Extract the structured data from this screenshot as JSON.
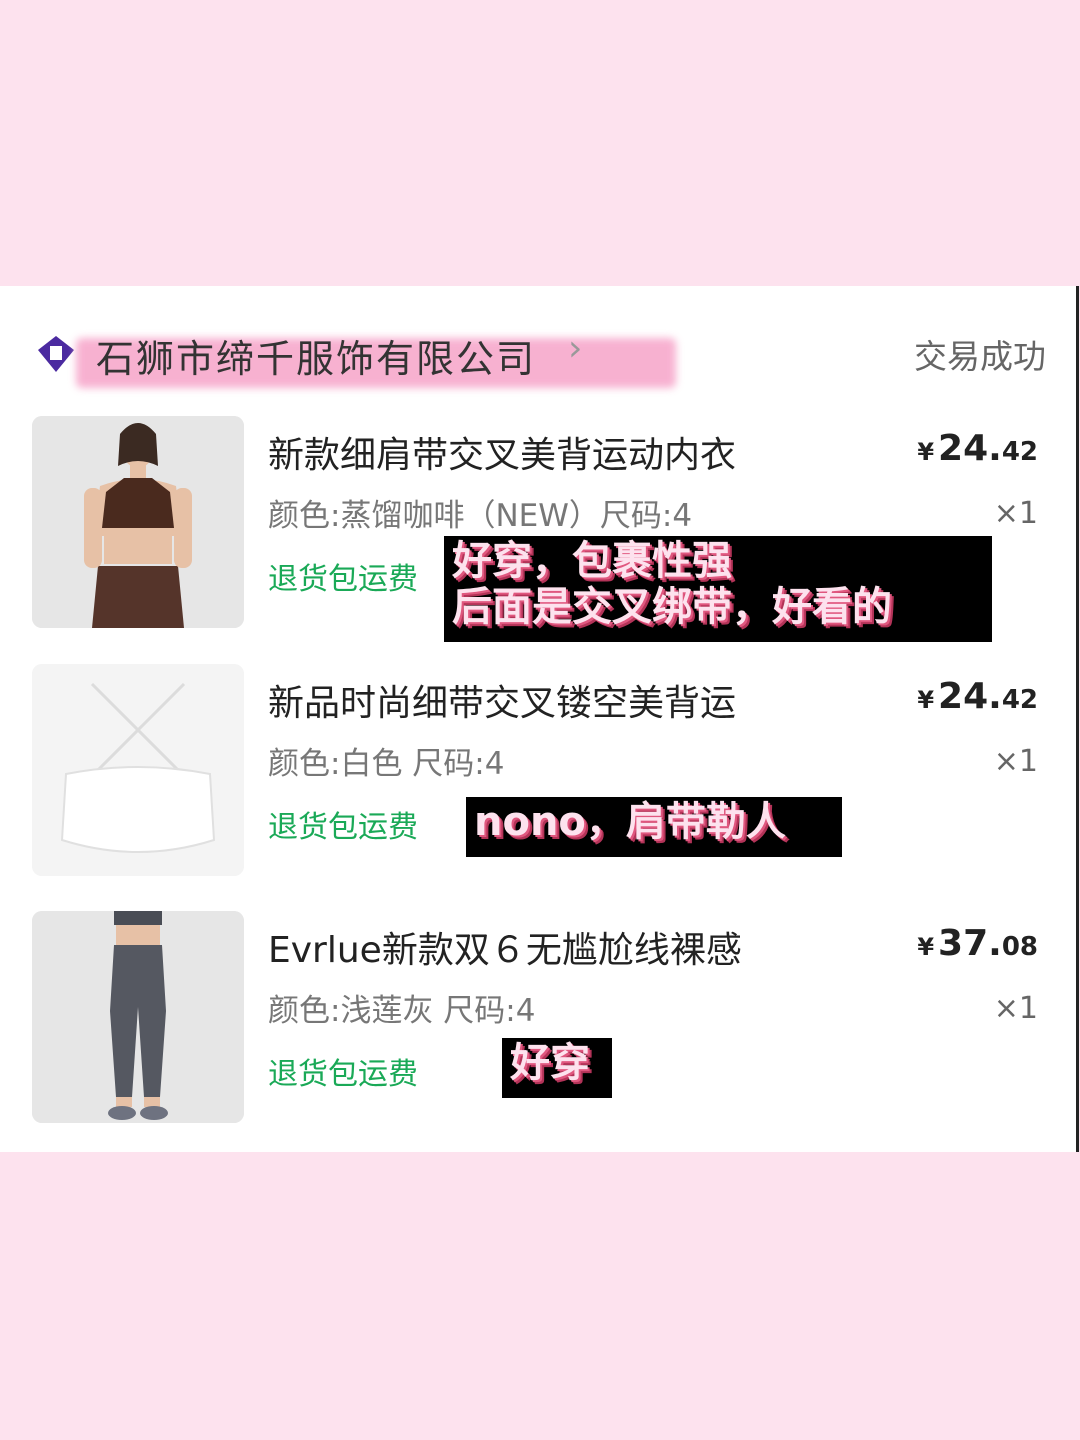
{
  "shop": {
    "name": "石狮市缔千服饰有限公司",
    "arrow": "›",
    "status": "交易成功"
  },
  "items": [
    {
      "title": "新款细肩带交叉美背运动内衣",
      "spec": "颜色:蒸馏咖啡（NEW）尺码:4",
      "refund": "退货包运费",
      "price_currency": "¥",
      "price_int": "24.",
      "price_dec": "42",
      "qty": "×1",
      "note": "好穿，包裹性强\n后面是交叉绑带，好看的",
      "image": "brown-sports-bra-photo"
    },
    {
      "title": "新品时尚细带交叉镂空美背运",
      "spec": "颜色:白色 尺码:4",
      "refund": "退货包运费",
      "price_currency": "¥",
      "price_int": "24.",
      "price_dec": "42",
      "qty": "×1",
      "note": "nono，肩带勒人",
      "image": "white-sports-bra-photo"
    },
    {
      "title": "Evrlue新款双６无尴尬线裸感",
      "spec": "颜色:浅莲灰 尺码:4",
      "refund": "退货包运费",
      "price_currency": "¥",
      "price_int": "37.",
      "price_dec": "08",
      "qty": "×1",
      "note": "好穿",
      "image": "grey-leggings-photo"
    }
  ],
  "colors": {
    "page_bg": "#fde2ee",
    "refund_green": "#1aa957",
    "note_text": "#fde2ee",
    "note_shadow": "#e0577f"
  }
}
